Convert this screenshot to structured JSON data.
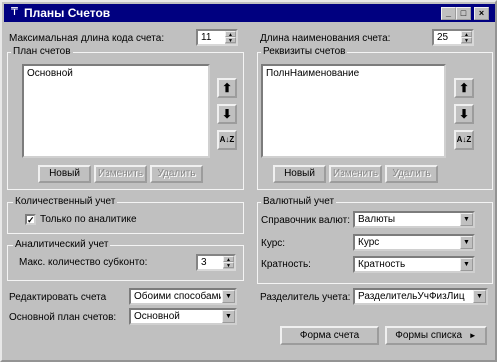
{
  "window": {
    "title": "Планы Счетов",
    "controls": {
      "minimize": "_",
      "maximize": "□",
      "close": "×"
    }
  },
  "left": {
    "code_length_label": "Максимальная длина кода счета:",
    "code_length_value": "11",
    "plans_group_title": "План счетов",
    "plans_items": [
      "Основной"
    ],
    "buttons": {
      "new": "Новый",
      "edit": "Изменить",
      "delete": "Удалить"
    },
    "quantity_group_title": "Количественный учет",
    "analytics_only_label": "Только по аналитике",
    "analytics_only_checked": true,
    "analytic_group_title": "Аналитический учет",
    "max_subconto_label": "Макс. количество субконто:",
    "max_subconto_value": "3",
    "edit_accounts_label": "Редактировать счета",
    "edit_accounts_value": "Обоими способами",
    "main_plan_label": "Основной план счетов:",
    "main_plan_value": "Основной"
  },
  "right": {
    "name_length_label": "Длина наименования счета:",
    "name_length_value": "25",
    "requisites_group_title": "Реквизиты счетов",
    "requisites_items": [
      "ПолнНаименование"
    ],
    "buttons": {
      "new": "Новый",
      "edit": "Изменить",
      "delete": "Удалить"
    },
    "currency_group_title": "Валютный учет",
    "currency_ref_label": "Справочник валют:",
    "currency_ref_value": "Валюты",
    "rate_label": "Курс:",
    "rate_value": "Курс",
    "multiplicity_label": "Кратность:",
    "multiplicity_value": "Кратность",
    "separator_label": "Разделитель учета:",
    "separator_value": "РазделительУчФизЛиц"
  },
  "footer": {
    "account_form": "Форма счета",
    "list_forms": "Формы списка",
    "list_forms_arrow": "►"
  },
  "icons": {
    "up": "⬆",
    "down": "⬇",
    "sort": "A↓Z"
  }
}
